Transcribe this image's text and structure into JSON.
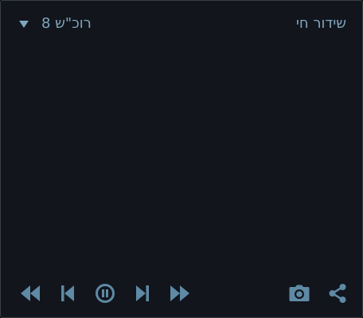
{
  "header": {
    "camera_select": {
      "value": "רוכ\"ש 8",
      "icon": "triangle-down-icon"
    },
    "title": "שידור חי"
  },
  "controls": {
    "playback": [
      {
        "name": "rewind-button",
        "icon": "rewind-icon"
      },
      {
        "name": "skip-back-button",
        "icon": "skip-back-icon"
      },
      {
        "name": "pause-button",
        "icon": "pause-circle-icon"
      },
      {
        "name": "skip-forward-button",
        "icon": "skip-forward-icon"
      },
      {
        "name": "fast-forward-button",
        "icon": "fast-forward-icon"
      }
    ],
    "actions": [
      {
        "name": "snapshot-button",
        "icon": "camera-icon"
      },
      {
        "name": "share-button",
        "icon": "share-icon"
      }
    ]
  },
  "colors": {
    "background": "#12151c",
    "border": "#3a3f45",
    "accent": "#7fa6bd",
    "icon": "#5e8aa5"
  }
}
